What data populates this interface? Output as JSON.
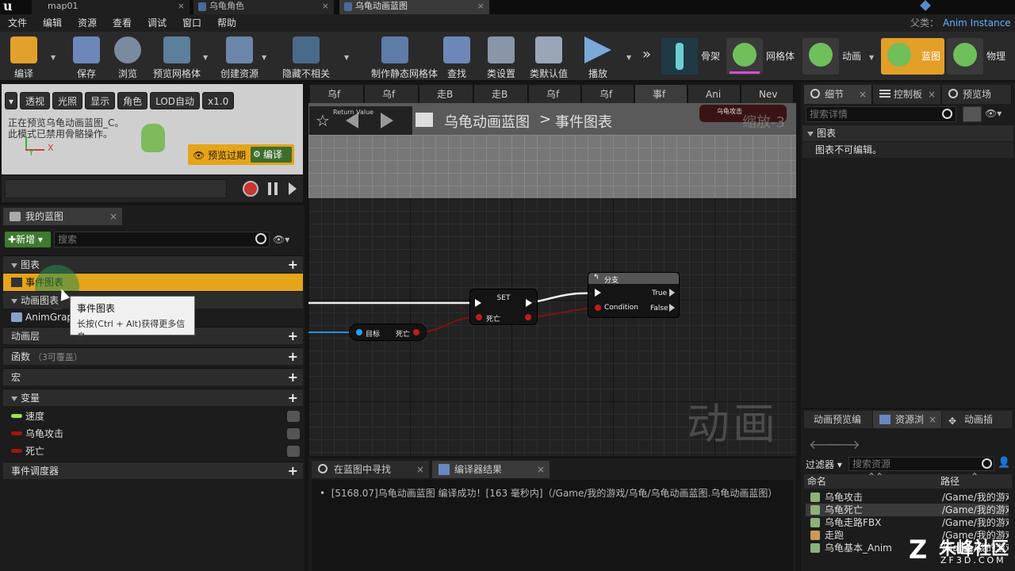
{
  "window": {
    "tabs": [
      {
        "label": "map01"
      },
      {
        "label": "乌龟角色"
      },
      {
        "label": "乌龟动画蓝图"
      }
    ]
  },
  "menubar": {
    "items": [
      "文件",
      "编辑",
      "资源",
      "查看",
      "调试",
      "窗口",
      "帮助"
    ],
    "parent_label": "父类：",
    "parent_value": "Anim Instance"
  },
  "toolbar": {
    "buttons": [
      {
        "label": "编译",
        "icon": "compile-icon"
      },
      {
        "label": "保存",
        "icon": "save-icon"
      },
      {
        "label": "浏览",
        "icon": "browse-icon"
      },
      {
        "label": "预览网格体",
        "icon": "preview-mesh-icon"
      },
      {
        "label": "创建资源",
        "icon": "create-asset-icon"
      },
      {
        "label": "隐藏不相关",
        "icon": "hide-unrelated-icon"
      },
      {
        "label": "制作静态网格体",
        "icon": "make-static-mesh-icon"
      },
      {
        "label": "查找",
        "icon": "find-icon"
      },
      {
        "label": "类设置",
        "icon": "class-settings-icon"
      },
      {
        "label": "类默认值",
        "icon": "class-defaults-icon"
      },
      {
        "label": "播放",
        "icon": "play-icon"
      }
    ],
    "modes": [
      {
        "label": "骨架"
      },
      {
        "label": "网格体"
      },
      {
        "label": "动画"
      },
      {
        "label": "蓝图"
      },
      {
        "label": "物理"
      }
    ]
  },
  "viewport": {
    "buttons": [
      "透视",
      "光照",
      "显示",
      "角色",
      "LOD自动",
      "x1.0"
    ],
    "line1": "正在预览乌龟动画蓝图_C。",
    "line2": "此模式已禁用骨骼操作。",
    "axis_x": "X",
    "axis_y": "Y",
    "preview_expired": "预览过期",
    "compile": "编译"
  },
  "my_blueprint": {
    "tab": "我的蓝图",
    "new_button": "新增",
    "search_placeholder": "搜索",
    "sections": {
      "graphs": "图表",
      "event_graph": "事件图表",
      "anim_graphs": "动画图表",
      "anim_graph_item": "AnimGraph",
      "anim_layers": "动画层",
      "functions": "函数",
      "functions_note": "（3可覆盖）",
      "macros": "宏",
      "variables": "变量",
      "dispatchers": "事件调度器"
    },
    "variables": [
      {
        "name": "速度",
        "color": "#9ee34a"
      },
      {
        "name": "乌龟攻击",
        "color": "#a11414"
      },
      {
        "name": "死亡",
        "color": "#a11414"
      }
    ],
    "tooltip": {
      "title": "事件图表",
      "body": "长按(Ctrl + Alt)获得更多信息"
    }
  },
  "graph": {
    "tabs": [
      "乌f",
      "乌f",
      "走B",
      "走B",
      "乌f",
      "乌f",
      "事f",
      "Ani",
      "Nev"
    ],
    "breadcrumb_root": "乌龟动画蓝图",
    "breadcrumb_sep": ">",
    "breadcrumb_leaf": "事件图表",
    "zoom": "缩放-3",
    "return_value": "Return Value",
    "top_node": "乌龟攻击",
    "watermark": "动画",
    "nodes": {
      "get_target": "目标",
      "get_dead": "死亡",
      "set_title": "SET",
      "set_dead": "死亡",
      "branch_title": "分支",
      "branch_true": "True",
      "branch_false": "False",
      "branch_condition": "Condition"
    }
  },
  "bottom_panel": {
    "tabs": [
      "在蓝图中寻找",
      "编译器结果"
    ],
    "message": "[5168.07]乌龟动画蓝图 编译成功！[163 毫秒内]（/Game/我的游戏/乌龟/乌龟动画蓝图.乌龟动画蓝图）"
  },
  "details": {
    "tabs": [
      "细节",
      "控制板",
      "预览场"
    ],
    "search_placeholder": "搜索详情",
    "section": "图表",
    "message": "图表不可编辑。"
  },
  "asset_panel": {
    "tabs": [
      "动画预览编",
      "资源浏",
      "动画插"
    ],
    "filter_label": "过滤器",
    "search_placeholder": "搜索资源",
    "col_name": "命名",
    "col_path": "路径",
    "rows": [
      {
        "name": "乌龟攻击",
        "path": "/Game/我的游戏"
      },
      {
        "name": "乌龟死亡",
        "path": "/Game/我的游戏"
      },
      {
        "name": "乌龟走路FBX",
        "path": "/Game/我的游戏"
      },
      {
        "name": "走跑",
        "path": "/Game/我的游戏"
      },
      {
        "name": "乌龟基本_Anim",
        "path": "/Game/我的游戏"
      }
    ]
  },
  "logo": {
    "text": "朱峰社区",
    "sub": "ZF3D.COM"
  }
}
